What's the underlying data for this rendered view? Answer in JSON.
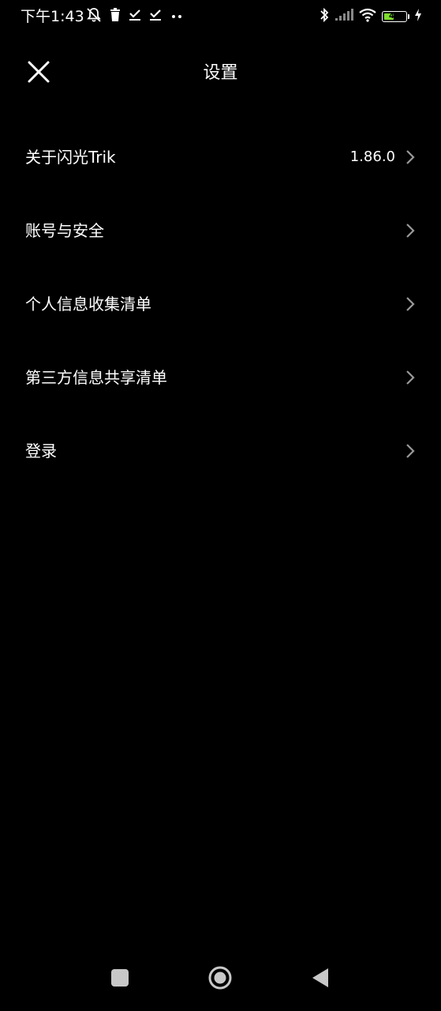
{
  "status_bar": {
    "time": "下午1:43",
    "battery_level": "43",
    "icons_left": [
      "mute-bell-icon",
      "trash-icon",
      "check-icon",
      "check-icon",
      "more-dots-icon"
    ],
    "icons_right": [
      "bluetooth-icon",
      "signal-icon",
      "wifi-icon",
      "battery-icon",
      "charging-icon"
    ],
    "battery_color": "#7ddc2b"
  },
  "header": {
    "title": "设置",
    "close_icon": "close-icon"
  },
  "settings": {
    "items": [
      {
        "label": "关于闪光Trik",
        "value": "1.86.0"
      },
      {
        "label": "账号与安全",
        "value": ""
      },
      {
        "label": "个人信息收集清单",
        "value": ""
      },
      {
        "label": "第三方信息共享清单",
        "value": ""
      },
      {
        "label": "登录",
        "value": ""
      }
    ]
  },
  "nav_bar": {
    "buttons": [
      "recent-apps-icon",
      "home-icon",
      "back-icon"
    ]
  },
  "colors": {
    "background": "#000000",
    "text": "#ffffff",
    "chevron": "#9a9a9a",
    "nav_icons": "#c8c8c8"
  }
}
